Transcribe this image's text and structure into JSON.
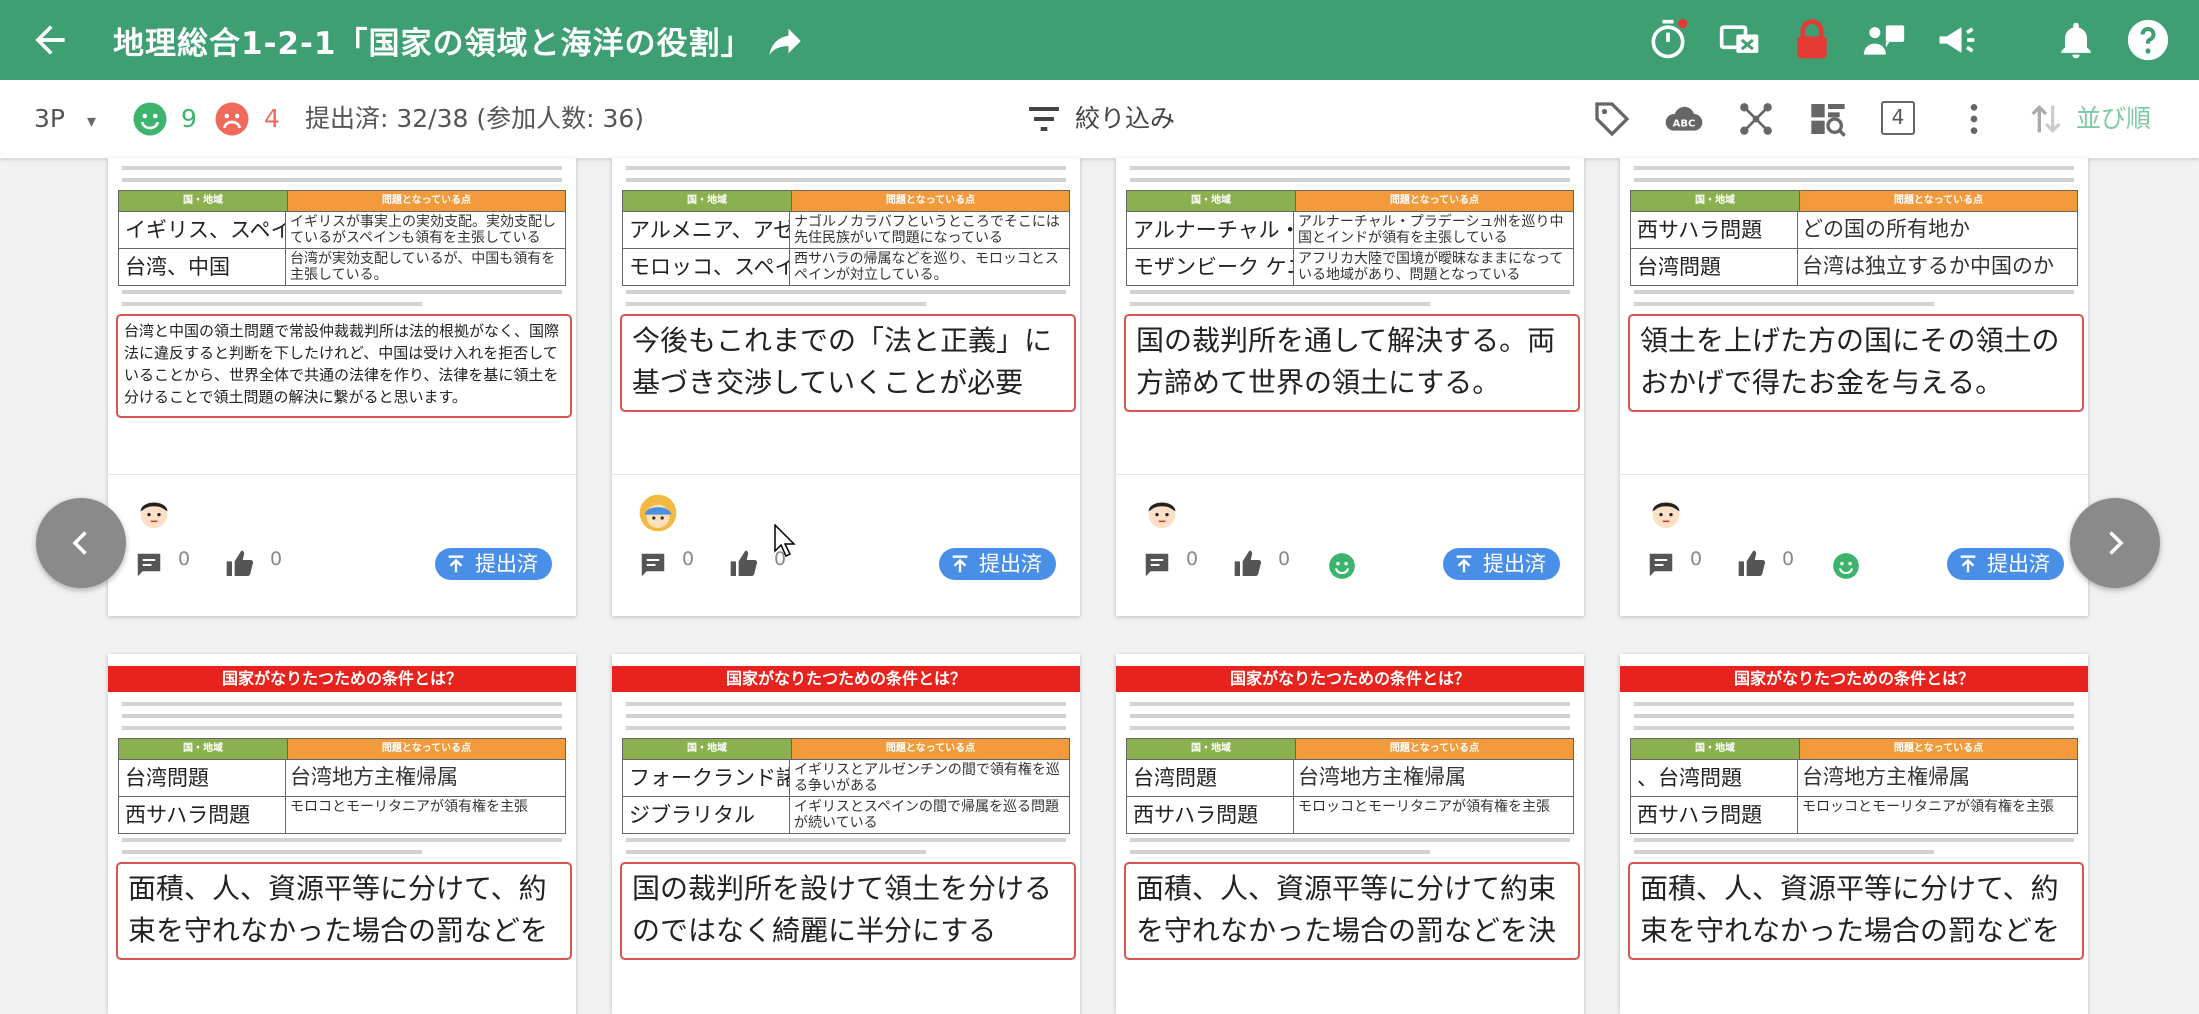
{
  "topbar": {
    "title": "地理総合1-2-1「国家の領域と海洋の役割」",
    "icons": [
      "back-arrow-icon",
      "share-icon",
      "timer-icon",
      "screen-share-icon",
      "lock-icon",
      "group-chat-icon",
      "megaphone-icon",
      "bell-icon",
      "help-icon"
    ]
  },
  "toolbar": {
    "class_select": "3P",
    "happy_count": "9",
    "sad_count": "4",
    "submission_status": "提出済: 32/38 (参加人数: 36)",
    "filter_label": "絞り込み",
    "column_count": "4",
    "sort_label": "並び順"
  },
  "sheet": {
    "header": "国家がなりたつための条件とは？",
    "col1": "国・地域",
    "col2": "問題となっている点"
  },
  "cards": [
    {
      "rows": [
        [
          "イギリス、スペイン",
          "イギリスが事実上の実効支配。実効支配しているがスペインも領有を主張している"
        ],
        [
          "台湾、中国",
          "台湾が実効支配しているが、中国も領有を主張している。"
        ]
      ],
      "answer": "台湾と中国の領土問題で常設仲裁裁判所は法的根拠がなく、国際法に違反すると判断を下したけれど、中国は受け入れを拒否していることから、世界全体で共通の法律を作り、法律を基に領土を分けることで領土問題の解決に繋がると思います。",
      "comments": "0",
      "likes": "0",
      "submitted": "提出済"
    },
    {
      "rows": [
        [
          "アルメニア、アゼルバイジャン",
          "ナゴルノカラバフというところでそこには先住民族がいて問題になっている"
        ],
        [
          "モロッコ、スペイン",
          "西サハラの帰属などを巡り、モロッコとスペインが対立している。"
        ]
      ],
      "answer": "今後もこれまでの「法と正義」に基づき交渉していくことが必要",
      "comments": "0",
      "likes": "0",
      "submitted": "提出済"
    },
    {
      "rows": [
        [
          "アルナーチャル・プラデーシュ州 中国 インド",
          "アルナーチャル・プラデーシュ州を巡り中国とインドが領有を主張している"
        ],
        [
          "モザンビーク ケニア ウガンダ",
          "アフリカ大陸で国境が曖昧なままになっている地域があり、問題となっている"
        ]
      ],
      "answer": "国の裁判所を通して解決する。両方諦めて世界の領土にする。",
      "comments": "0",
      "likes": "0",
      "submitted": "提出済"
    },
    {
      "rows": [
        [
          "西サハラ問題",
          "どの国の所有地か"
        ],
        [
          "台湾問題",
          "台湾は独立するか中国のか"
        ]
      ],
      "answer": "領土を上げた方の国にその領土のおかげで得たお金を与える。",
      "comments": "0",
      "likes": "0",
      "submitted": "提出済"
    },
    {
      "rows": [
        [
          "台湾問題",
          "台湾地方主権帰属"
        ],
        [
          "西サハラ問題",
          "モロコとモーリタニアが領有権を主張"
        ]
      ],
      "answer": "面積、人、資源平等に分けて、約束を守れなかった場合の罰などを決める。"
    },
    {
      "rows": [
        [
          "フォークランド諸島",
          "イギリスとアルゼンチンの間で領有権を巡る争いがある"
        ],
        [
          "ジブラリタル",
          "イギリスとスペインの間で帰属を巡る問題が続いている"
        ]
      ],
      "answer": "国の裁判所を設けて領土を分けるのではなく綺麗に半分にする"
    },
    {
      "rows": [
        [
          "台湾問題",
          "台湾地方主権帰属"
        ],
        [
          "西サハラ問題",
          "モロッコとモーリタニアが領有権を主張"
        ]
      ],
      "answer": "面積、人、資源平等に分けて約束を守れなかった場合の罰などを決める"
    },
    {
      "rows": [
        [
          "、台湾問題",
          "台湾地方主権帰属"
        ],
        [
          "西サハラ問題",
          "モロッコとモーリタニアが領有権を主張"
        ]
      ],
      "answer": "面積、人、資源平等に分けて、約束を守れなかった場合の罰などを決める。"
    }
  ]
}
